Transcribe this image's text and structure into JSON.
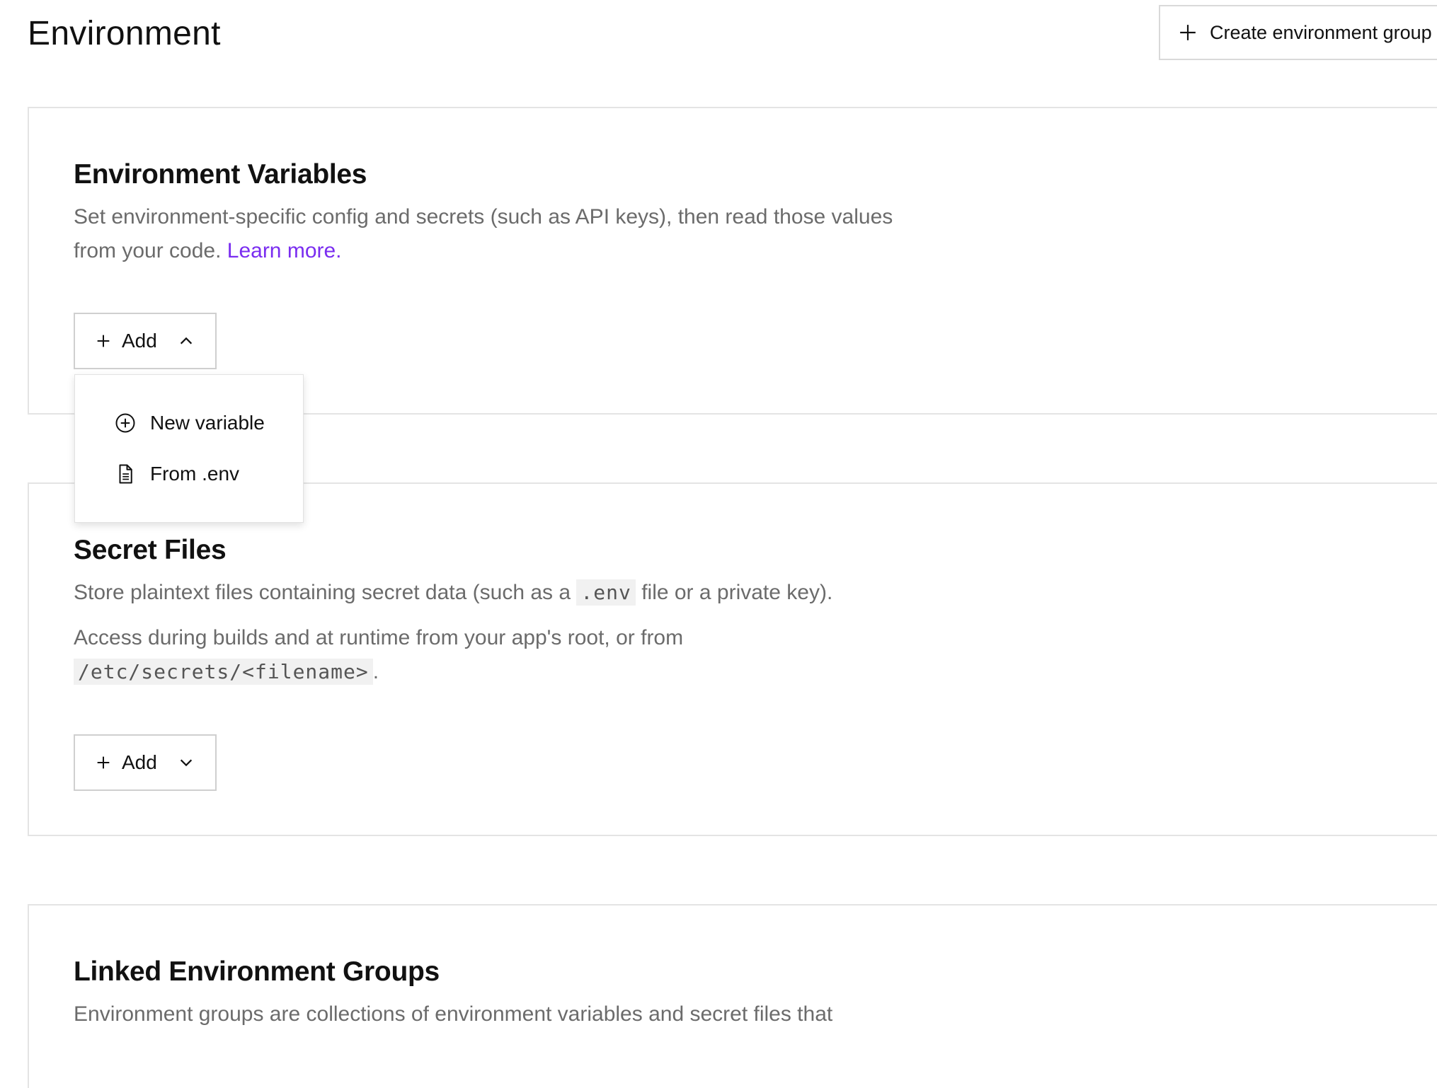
{
  "header": {
    "title": "Environment",
    "create_group_label": "Create environment group"
  },
  "env_vars": {
    "title": "Environment Variables",
    "desc_text": "Set environment-specific config and secrets (such as API keys), then read those values from your code.",
    "learn_more": "Learn more.",
    "add_label": "Add",
    "dropdown": {
      "items": [
        {
          "label": "New variable",
          "icon": "plus-circle-icon"
        },
        {
          "label": "From .env",
          "icon": "file-icon"
        }
      ]
    }
  },
  "secret_files": {
    "title": "Secret Files",
    "desc1_before": "Store plaintext files containing secret data (such as a",
    "desc1_code": ".env",
    "desc1_after": "file or a private key).",
    "desc2_before": "Access during builds and at runtime from your app's root, or from",
    "desc2_code": "/etc/secrets/<filename>",
    "desc2_after": ".",
    "add_label": "Add"
  },
  "linked_groups": {
    "title": "Linked Environment Groups",
    "desc_text": "Environment groups are collections of environment variables and secret files that"
  },
  "colors": {
    "link": "#7a2df0",
    "muted_text": "#6b6b6b",
    "border": "#e4e4e4"
  }
}
